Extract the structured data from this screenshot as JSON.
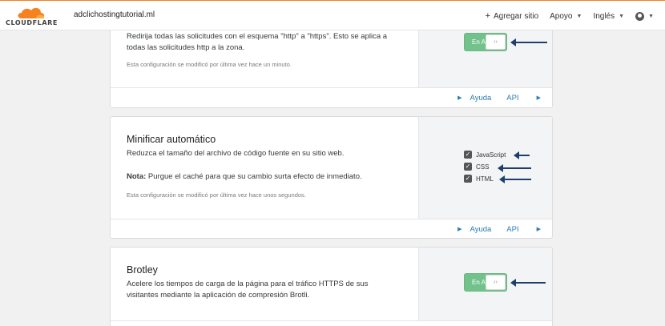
{
  "header": {
    "logo_text": "CLOUDFLARE",
    "domain": "adclichostingtutorial.ml",
    "add_site": "Agregar sitio",
    "support": "Apoyo",
    "language": "Inglés"
  },
  "always_https": {
    "desc_line1": "Redirija todas las solicitudes con el esquema \"http\" a \"https\". Esto se aplica a",
    "desc_line2": "todas las solicitudes http a la zona.",
    "note": "Esta configuración se modificó por última vez hace un minuto.",
    "toggle_label": "En A",
    "help": "Ayuda",
    "api": "API"
  },
  "auto_minify": {
    "title": "Minificar automático",
    "desc": "Reduzca el tamaño del archivo de código fuente en su sitio web.",
    "note_label": "Nota:",
    "note_text": " Purgue el caché para que su cambio surta efecto de inmediato.",
    "note": "Esta configuración se modificó por última vez hace unos segundos.",
    "options": [
      "JavaScript",
      "CSS",
      "HTML"
    ],
    "help": "Ayuda",
    "api": "API"
  },
  "brotli": {
    "title": "Brotley",
    "desc_line1": "Acelere los tiempos de carga de la página para el tráfico HTTPS de sus",
    "desc_line2": "visitantes mediante la aplicación de compresión Brotli.",
    "toggle_label": "En A"
  },
  "colors": {
    "accent_orange": "#f6821f",
    "toggle_green": "#72c28c",
    "link_blue": "#2c7cb0",
    "arrow_navy": "#1f3f6b"
  }
}
